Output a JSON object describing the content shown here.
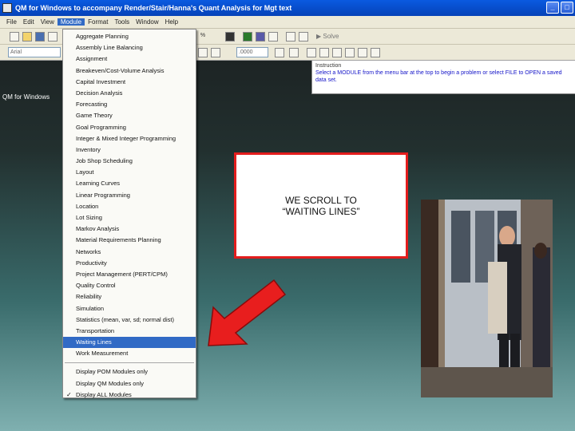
{
  "window": {
    "title": "QM for Windows to accompany Render/Stair/Hanna's Quant Analysis for Mgt text",
    "controls": [
      "_",
      "□"
    ]
  },
  "menubar": {
    "items": [
      "File",
      "Edit",
      "View",
      "Module",
      "Format",
      "Tools",
      "Window",
      "Help"
    ],
    "active": "Module"
  },
  "toolbar": {
    "font_combo": "Arial",
    "number_format": ".0000",
    "solve_label": "Solve",
    "zoom_glyph": "%"
  },
  "instruction_panel": {
    "header": "Instruction",
    "text": "Select a MODULE from the menu bar at the top to begin a problem or select FILE to OPEN a saved data set."
  },
  "workspace": {
    "label": "QM for Windows"
  },
  "module_menu": {
    "items": [
      "Aggregate Planning",
      "Assembly Line Balancing",
      "Assignment",
      "Breakeven/Cost-Volume Analysis",
      "Capital Investment",
      "Decision Analysis",
      "Forecasting",
      "Game Theory",
      "Goal Programming",
      "Integer & Mixed Integer Programming",
      "Inventory",
      "Job Shop Scheduling",
      "Layout",
      "Learning Curves",
      "Linear Programming",
      "Location",
      "Lot Sizing",
      "Markov Analysis",
      "Material Requirements Planning",
      "Networks",
      "Productivity",
      "Project Management (PERT/CPM)",
      "Quality Control",
      "Reliability",
      "Simulation",
      "Statistics (mean, var, sd; normal dist)",
      "Transportation",
      "Waiting Lines",
      "Work Measurement"
    ],
    "selected": "Waiting Lines",
    "display_options": [
      "Display POM Modules only",
      "Display QM Modules only",
      "Display ALL Modules"
    ],
    "checked_option": "Display ALL Modules",
    "check_glyph": "✓"
  },
  "callout": {
    "line1": "WE SCROLL TO",
    "line2": "“WAITING LINES”",
    "border_color": "#e31d1d"
  },
  "arrow": {
    "color": "#e81e1e"
  }
}
